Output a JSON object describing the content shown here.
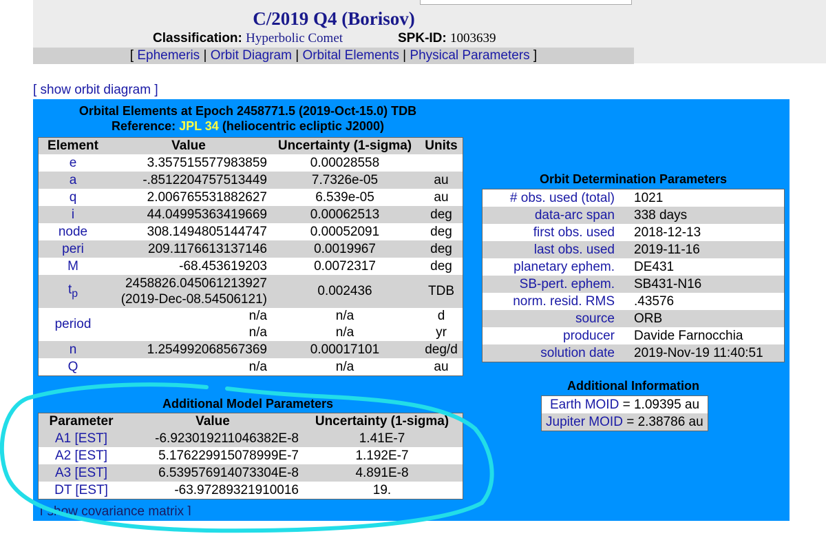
{
  "header": {
    "title": "C/2019 Q4 (Borisov)",
    "classification_label": "Classification:",
    "classification_value": "Hyperbolic Comet",
    "spk_label": "SPK-ID:",
    "spk_value": "1003639"
  },
  "nav": {
    "open": "[",
    "close": "]",
    "sep": "|",
    "items": [
      "Ephemeris",
      "Orbit Diagram",
      "Orbital Elements",
      "Physical Parameters"
    ]
  },
  "show_orbit_diagram": "[ show orbit diagram ]",
  "orbital": {
    "heading_line1": "Orbital Elements at Epoch 2458771.5 (2019-Oct-15.0) TDB",
    "ref_label": "Reference:",
    "ref_link": "JPL 34",
    "ref_suffix": "(heliocentric ecliptic J2000)",
    "columns": [
      "Element",
      "Value",
      "Uncertainty (1-sigma)",
      "Units"
    ],
    "rows": [
      {
        "element": "e",
        "value": "3.357515577983859",
        "unc": "0.00028558",
        "units": ""
      },
      {
        "element": "a",
        "value": "-.8512204757513449",
        "unc": "7.7326e-05",
        "units": "au"
      },
      {
        "element": "q",
        "value": "2.006765531882627",
        "unc": "6.539e-05",
        "units": "au"
      },
      {
        "element": "i",
        "value": "44.04995363419669",
        "unc": "0.00062513",
        "units": "deg"
      },
      {
        "element": "node",
        "value": "308.1494805144747",
        "unc": "0.00052091",
        "units": "deg"
      },
      {
        "element": "peri",
        "value": "209.1176613137146",
        "unc": "0.0019967",
        "units": "deg"
      },
      {
        "element": "M",
        "value": "-68.453619203",
        "unc": "0.0072317",
        "units": "deg"
      }
    ],
    "tp": {
      "element": "t",
      "sub": "p",
      "value1": "2458826.045061213927",
      "value2": "(2019-Dec-08.54506121)",
      "unc": "0.002436",
      "units": "TDB"
    },
    "period": {
      "element": "period",
      "value1": "n/a",
      "value2": "n/a",
      "unc1": "n/a",
      "unc2": "n/a",
      "units1": "d",
      "units2": "yr"
    },
    "rows_after": [
      {
        "element": "n",
        "value": "1.254992068567369",
        "unc": "0.00017101",
        "units": "deg/d"
      },
      {
        "element": "Q",
        "value": "n/a",
        "unc": "n/a",
        "units": "au"
      }
    ]
  },
  "orbit_determination": {
    "heading": "Orbit Determination Parameters",
    "rows": [
      {
        "key": "# obs. used (total)",
        "value": "1021"
      },
      {
        "key": "data-arc span",
        "value": "338 days"
      },
      {
        "key": "first obs. used",
        "value": "2018-12-13"
      },
      {
        "key": "last obs. used",
        "value": "2019-11-16"
      },
      {
        "key": "planetary ephem.",
        "value": "DE431"
      },
      {
        "key": "SB-pert. ephem.",
        "value": "SB431-N16"
      },
      {
        "key": "norm. resid. RMS",
        "value": ".43576"
      },
      {
        "key": "source",
        "value": "ORB"
      },
      {
        "key": "producer",
        "value": "Davide Farnocchia"
      },
      {
        "key": "solution date",
        "value": "2019-Nov-19 11:40:51"
      }
    ]
  },
  "additional_info": {
    "heading": "Additional Information",
    "earth_label": "Earth MOID",
    "earth_value": "= 1.09395 au",
    "jupiter_label": "Jupiter MOID",
    "jupiter_value": "= 2.38786 au"
  },
  "model_params": {
    "heading": "Additional Model Parameters",
    "columns": [
      "Parameter",
      "Value",
      "Uncertainty (1-sigma)"
    ],
    "rows": [
      {
        "param": "A1 [EST]",
        "value": "-6.923019211046382E-8",
        "unc": "1.41E-7"
      },
      {
        "param": "A2 [EST]",
        "value": "5.176229915078999E-7",
        "unc": "1.192E-7"
      },
      {
        "param": "A3 [EST]",
        "value": "6.539576914073304E-8",
        "unc": "4.891E-8"
      },
      {
        "param": "DT [EST]",
        "value": "-63.97289321910016",
        "unc": "19."
      }
    ]
  },
  "show_covariance": "[ show covariance matrix ]",
  "colors": {
    "panel": "#0092ff",
    "link": "#1a1aa6",
    "title": "#1a1a8c",
    "annotation": "#22dde8",
    "reference_link": "#ffff40"
  }
}
